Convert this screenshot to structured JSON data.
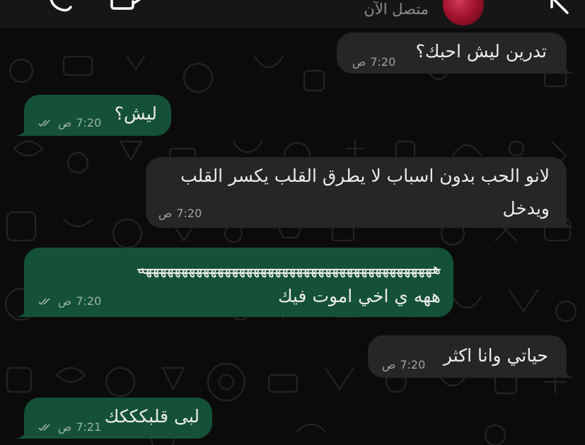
{
  "header": {
    "status": "متصل الآن"
  },
  "messages": [
    {
      "direction": "in",
      "text": "تدرين ليش احبك؟",
      "time": "7:20",
      "ampm": "ص"
    },
    {
      "direction": "out",
      "text": "ليش؟",
      "time": "7:20",
      "ampm": "ص"
    },
    {
      "direction": "in",
      "lines": [
        "لانو الحب بدون اسباب لا يطرق  القلب يكسر القلب",
        "ويدخل"
      ],
      "time": "7:20",
      "ampm": "ص"
    },
    {
      "direction": "out",
      "lines": [
        "هههههههههههههههههههههههههههههههههههههههههه",
        "ههه ي اخي اموت فيك"
      ],
      "time": "7:20",
      "ampm": "ص"
    },
    {
      "direction": "in",
      "text": "حياتي وانا اكثر",
      "time": "7:20",
      "ampm": "ص"
    },
    {
      "direction": "out",
      "text": "لبى قلبكككك",
      "time": "7:21",
      "ampm": "ص"
    }
  ],
  "colors": {
    "incoming_bubble": "#262626",
    "outgoing_bubble": "#145137",
    "background": "#0b0b0b"
  },
  "icons": [
    "back-arrow-icon",
    "video-call-icon",
    "phone-call-icon",
    "more-icon",
    "read-receipt-icon"
  ]
}
